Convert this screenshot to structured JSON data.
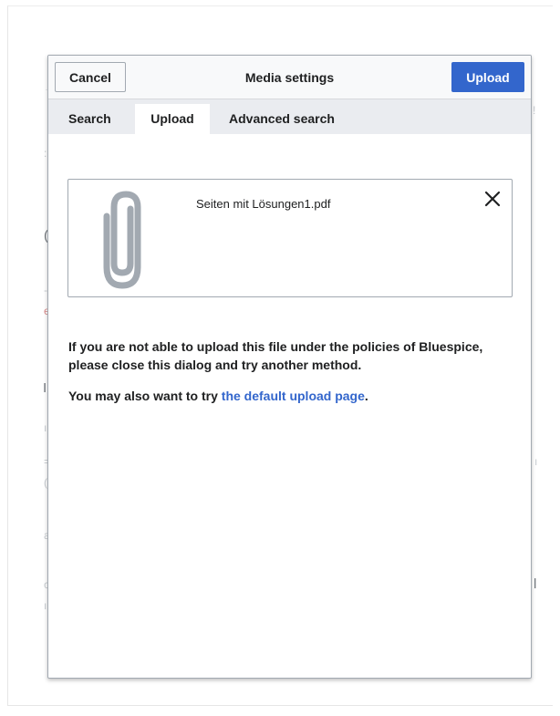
{
  "dialog": {
    "title": "Media settings",
    "cancel_label": "Cancel",
    "upload_label": "Upload"
  },
  "tabs": [
    {
      "label": "Search",
      "active": false
    },
    {
      "label": "Upload",
      "active": true
    },
    {
      "label": "Advanced search",
      "active": false
    }
  ],
  "file": {
    "name": "Seiten mit Lösungen1.pdf",
    "icon": "paperclip-icon",
    "remove_icon": "close-icon"
  },
  "message": {
    "policy_text": "If you are not able to upload this file under the policies of Bluespice, please close this dialog and try another method.",
    "alt_prefix": "You may also want to try ",
    "alt_link": "the default upload page",
    "alt_suffix": "."
  },
  "colors": {
    "primary": "#3366cc",
    "tab_bar": "#eaecf0",
    "icon_gray": "#a2a9b1"
  }
}
